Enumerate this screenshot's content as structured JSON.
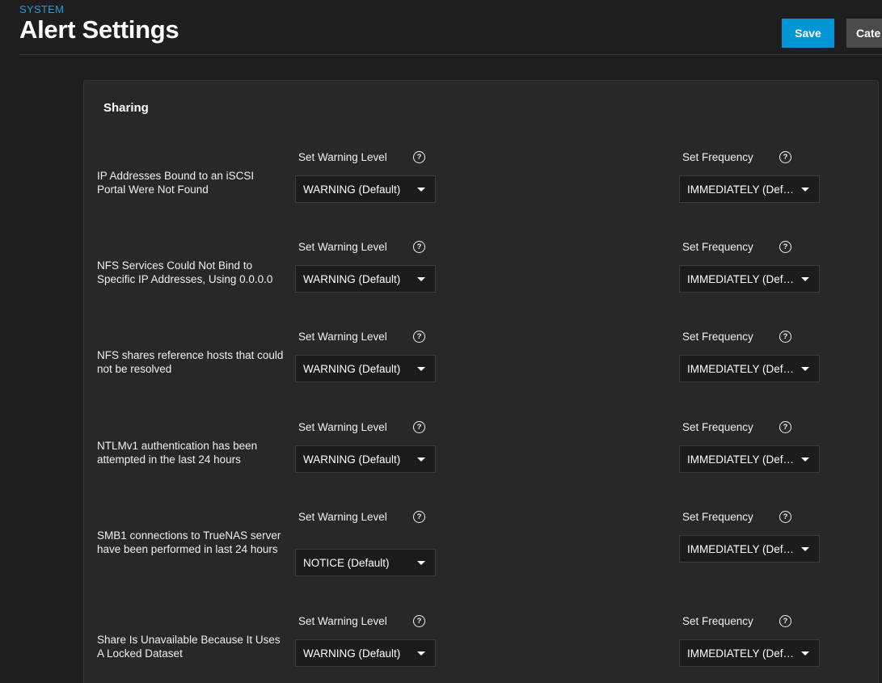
{
  "header": {
    "breadcrumb": "SYSTEM",
    "title": "Alert Settings",
    "save_label": "Save",
    "cancel_label": "Cate"
  },
  "section": {
    "title": "Sharing"
  },
  "labels": {
    "warning_level": "Set Warning Level",
    "frequency": "Set Frequency",
    "help": "?"
  },
  "alerts": [
    {
      "name": "IP Addresses Bound to an iSCSI Portal Were Not Found",
      "level": "WARNING (Default)",
      "frequency": "IMMEDIATELY (Default)"
    },
    {
      "name": "NFS Services Could Not Bind to Specific IP Addresses, Using 0.0.0.0",
      "level": "WARNING (Default)",
      "frequency": "IMMEDIATELY (Default)"
    },
    {
      "name": "NFS shares reference hosts that could not be resolved",
      "level": "WARNING (Default)",
      "frequency": "IMMEDIATELY (Default)"
    },
    {
      "name": "NTLMv1 authentication has been attempted in the last 24 hours",
      "level": "WARNING (Default)",
      "frequency": "IMMEDIATELY (Default)"
    },
    {
      "name": "SMB1 connections to TrueNAS server have been performed in last 24 hours",
      "level": "NOTICE (Default)",
      "frequency": "IMMEDIATELY (Default)"
    },
    {
      "name": "Share Is Unavailable Because It Uses A Locked Dataset",
      "level": "WARNING (Default)",
      "frequency": "IMMEDIATELY (Default)"
    }
  ]
}
